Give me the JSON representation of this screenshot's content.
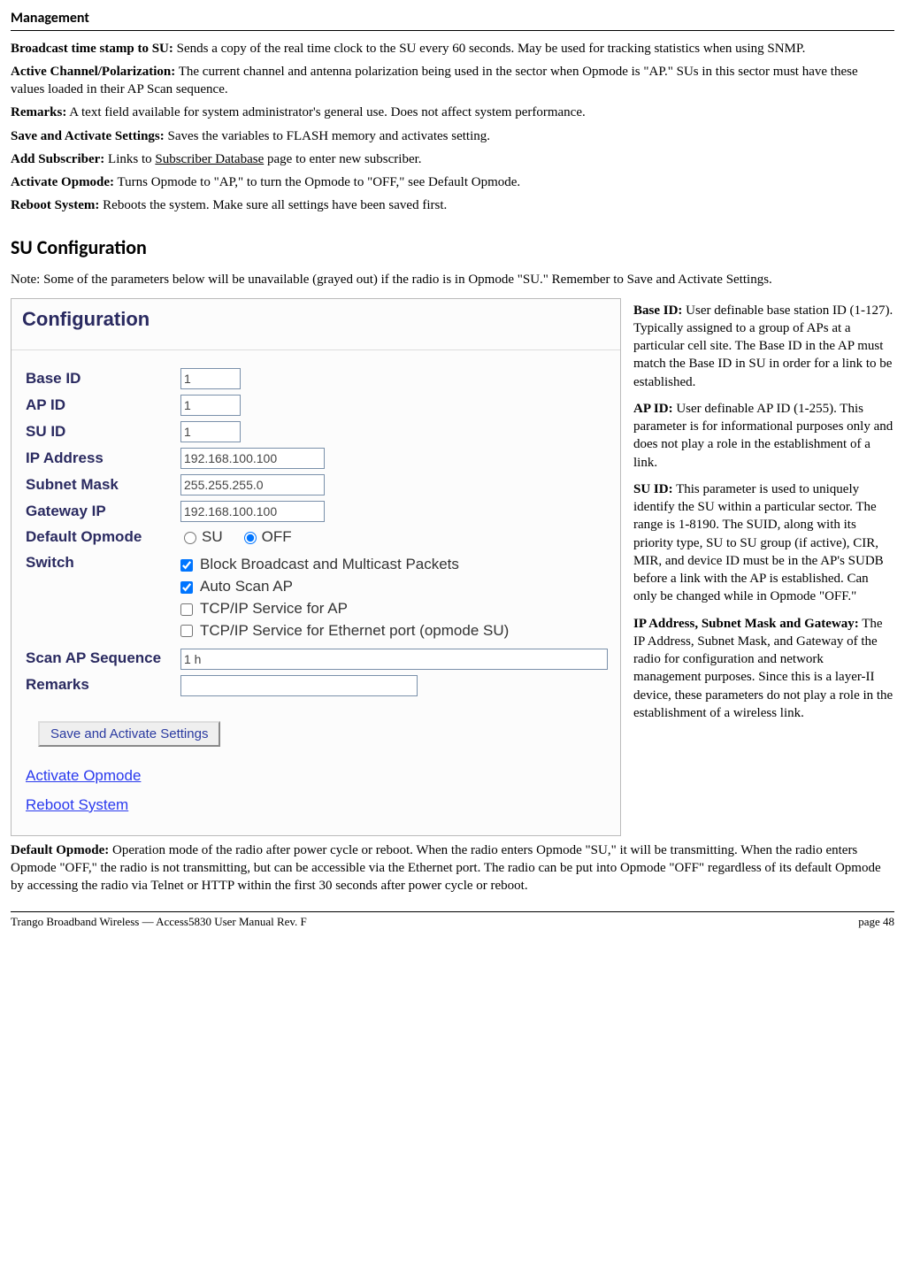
{
  "header": {
    "title": "Management"
  },
  "intro": [
    {
      "label": "Broadcast time stamp to SU:",
      "text": "  Sends a copy of the real time clock to the SU every 60 seconds. May be used for tracking statistics when using SNMP."
    },
    {
      "label": "Active Channel/Polarization:",
      "text": " The current channel and antenna polarization being used in the sector when Opmode is \"AP.\"  SUs in this sector must have these values loaded in their AP Scan sequence."
    },
    {
      "label": "Remarks:",
      "text": " A text field available for system administrator's general use.  Does not affect system performance."
    },
    {
      "label": "Save and Activate Settings:",
      "text": " Saves the variables to FLASH memory and activates setting."
    },
    {
      "label": "Add Subscriber:",
      "text_before": " Links to ",
      "link": "Subscriber Database",
      "text_after": " page to enter new subscriber."
    },
    {
      "label": "Activate Opmode:",
      "text": " Turns Opmode to \"AP,\" to turn the Opmode to \"OFF,\" see Default Opmode."
    },
    {
      "label": "Reboot System:",
      "text": " Reboots the system.  Make sure all settings have been saved first."
    }
  ],
  "section_title": "SU Configuration",
  "section_note": "Note:  Some of the parameters below will be unavailable (grayed out) if the radio is in Opmode \"SU.\"  Remember to Save and Activate Settings.",
  "config": {
    "title": "Configuration",
    "fields": {
      "base_id": {
        "label": "Base ID",
        "value": "1"
      },
      "ap_id": {
        "label": "AP ID",
        "value": "1"
      },
      "su_id": {
        "label": "SU ID",
        "value": "1"
      },
      "ip": {
        "label": "IP Address",
        "value": "192.168.100.100"
      },
      "mask": {
        "label": "Subnet Mask",
        "value": "255.255.255.0"
      },
      "gateway": {
        "label": "Gateway IP",
        "value": "192.168.100.100"
      }
    },
    "default_opmode_label": "Default Opmode",
    "opmode_options": {
      "su": "SU",
      "off": "OFF"
    },
    "switch_label": "Switch",
    "switches": [
      {
        "label": "Block Broadcast and Multicast Packets",
        "checked": true
      },
      {
        "label": "Auto Scan AP",
        "checked": true
      },
      {
        "label": "TCP/IP Service for AP",
        "checked": false
      },
      {
        "label": "TCP/IP Service for Ethernet port (opmode SU)",
        "checked": false
      }
    ],
    "scan_label": "Scan AP Sequence",
    "scan_value": "1 h",
    "remarks_label": "Remarks",
    "save_button": "Save and Activate Settings",
    "links": {
      "activate": "Activate Opmode",
      "reboot": "Reboot System"
    }
  },
  "side": [
    {
      "label": "Base ID:",
      "text": "  User definable base station ID (1-127).  Typically assigned to a group of APs at a particular cell site.  The Base ID in the AP must match the Base ID in SU in order for a link to be established."
    },
    {
      "label": "AP ID:",
      "text": "  User definable AP ID (1-255).  This parameter is for informational purposes only and does not play a role in the establishment of a link."
    },
    {
      "label": "SU ID:",
      "text": "  This parameter is used to uniquely identify the SU within a particular sector.  The range is 1-8190.  The SUID, along with its priority type, SU to SU group (if active), CIR, MIR, and device ID must be in the AP's SUDB before a link with the AP is established.  Can only be changed while in Opmode \"OFF.\""
    },
    {
      "label": "IP Address, Subnet Mask and Gateway:",
      "text": "  The IP Address, Subnet Mask, and Gateway of the radio for configuration and network management purposes.  Since this is a layer-II device, these parameters do not play a role in the establishment of a wireless link."
    }
  ],
  "bottom": {
    "label": "Default Opmode:",
    "text": " Operation mode of the radio after power cycle or reboot.  When the radio enters Opmode \"SU,\" it will be transmitting.  When the radio enters Opmode \"OFF,\" the radio is not transmitting, but can be accessible via the Ethernet port.  The radio can be put into Opmode \"OFF\" regardless of its default Opmode by accessing the radio via Telnet or HTTP within the first 30 seconds after power cycle or reboot."
  },
  "footer": {
    "left": "Trango Broadband Wireless — Access5830 User Manual  Rev. F",
    "right": "page 48"
  }
}
